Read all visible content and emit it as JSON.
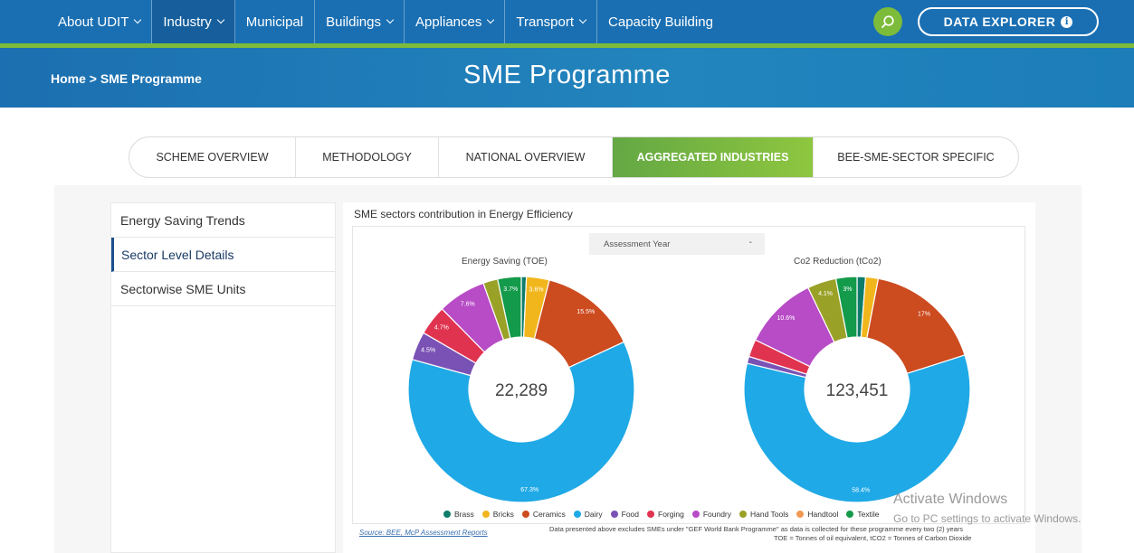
{
  "nav": {
    "items": [
      {
        "label": "About UDIT",
        "dropdown": true,
        "active": false
      },
      {
        "label": "Industry",
        "dropdown": true,
        "active": true
      },
      {
        "label": "Municipal",
        "dropdown": false,
        "active": false
      },
      {
        "label": "Buildings",
        "dropdown": true,
        "active": false
      },
      {
        "label": "Appliances",
        "dropdown": true,
        "active": false
      },
      {
        "label": "Transport",
        "dropdown": true,
        "active": false
      },
      {
        "label": "Capacity Building",
        "dropdown": false,
        "active": false
      }
    ],
    "data_explorer_label": "DATA EXPLORER",
    "info_glyph": "i"
  },
  "banner": {
    "breadcrumb": "Home > SME Programme",
    "title": "SME Programme"
  },
  "tabs": [
    {
      "label": "SCHEME OVERVIEW",
      "active": false
    },
    {
      "label": "METHODOLOGY",
      "active": false
    },
    {
      "label": "NATIONAL OVERVIEW",
      "active": false
    },
    {
      "label": "AGGREGATED INDUSTRIES",
      "active": true
    },
    {
      "label": "BEE-SME-SECTOR SPECIFIC",
      "active": false
    }
  ],
  "sidebar": {
    "items": [
      {
        "label": "Energy Saving Trends",
        "active": false
      },
      {
        "label": "Sector Level Details",
        "active": true
      },
      {
        "label": "Sectorwise SME Units",
        "active": false
      }
    ]
  },
  "panel": {
    "title": "SME sectors contribution in Energy Efficiency",
    "year_select": {
      "placeholder": "Assessment Year",
      "arrow": "-"
    },
    "source": "Source: BEE, McP Assessment Reports",
    "note1": "Data presented above excludes SMEs under \"GEF World Bank Programme\" as data is collected for these programme every two (2) years",
    "note2": "TOE = Tonnes of oil equivalent,    tCO2 = Tonnes of Carbon Dioxide"
  },
  "colors": {
    "nav_bg": "#1a6fb3",
    "accent_green": "#7dbb3a",
    "sectors": {
      "Brass": "#0e7c6b",
      "Bricks": "#f2b61d",
      "Ceramics": "#cc4b1f",
      "Dairy": "#1fa9e6",
      "Food": "#7a52b5",
      "Forging": "#e0334f",
      "Foundry": "#b74cc6",
      "Hand Tools": "#9aa127",
      "Handtool": "#f29a54",
      "Textile": "#149a4b"
    }
  },
  "chart_data": [
    {
      "type": "pie",
      "title": "Energy Saving (TOE)",
      "center_value": "22,289",
      "categories": [
        "Brass",
        "Bricks",
        "Ceramics",
        "Dairy",
        "Food",
        "Forging",
        "Foundry",
        "Hand Tools",
        "Textile"
      ],
      "values": [
        0.8,
        3.6,
        15.5,
        67.3,
        4.5,
        4.7,
        7.6,
        2.3,
        3.7
      ],
      "labels": [
        "",
        "3.6%",
        "15.5%",
        "67.3%",
        "4.5%",
        "4.7%",
        "7.6%",
        "",
        "3.7%"
      ]
    },
    {
      "type": "pie",
      "title": "Co2 Reduction (tCo2)",
      "center_value": "123,451",
      "categories": [
        "Brass",
        "Bricks",
        "Ceramics",
        "Dairy",
        "Food",
        "Forging",
        "Foundry",
        "Hand Tools",
        "Textile"
      ],
      "values": [
        1.2,
        1.8,
        17,
        58.4,
        1.0,
        2.5,
        10.6,
        4.1,
        3.0
      ],
      "labels": [
        "",
        "",
        "17%",
        "58.4%",
        "",
        "",
        "10.6%",
        "4.1%",
        "3%"
      ]
    }
  ],
  "legend": [
    "Brass",
    "Bricks",
    "Ceramics",
    "Dairy",
    "Food",
    "Forging",
    "Foundry",
    "Hand Tools",
    "Handtool",
    "Textile"
  ],
  "watermark": {
    "line1": "Activate Windows",
    "line2": "Go to PC settings to activate Windows."
  }
}
